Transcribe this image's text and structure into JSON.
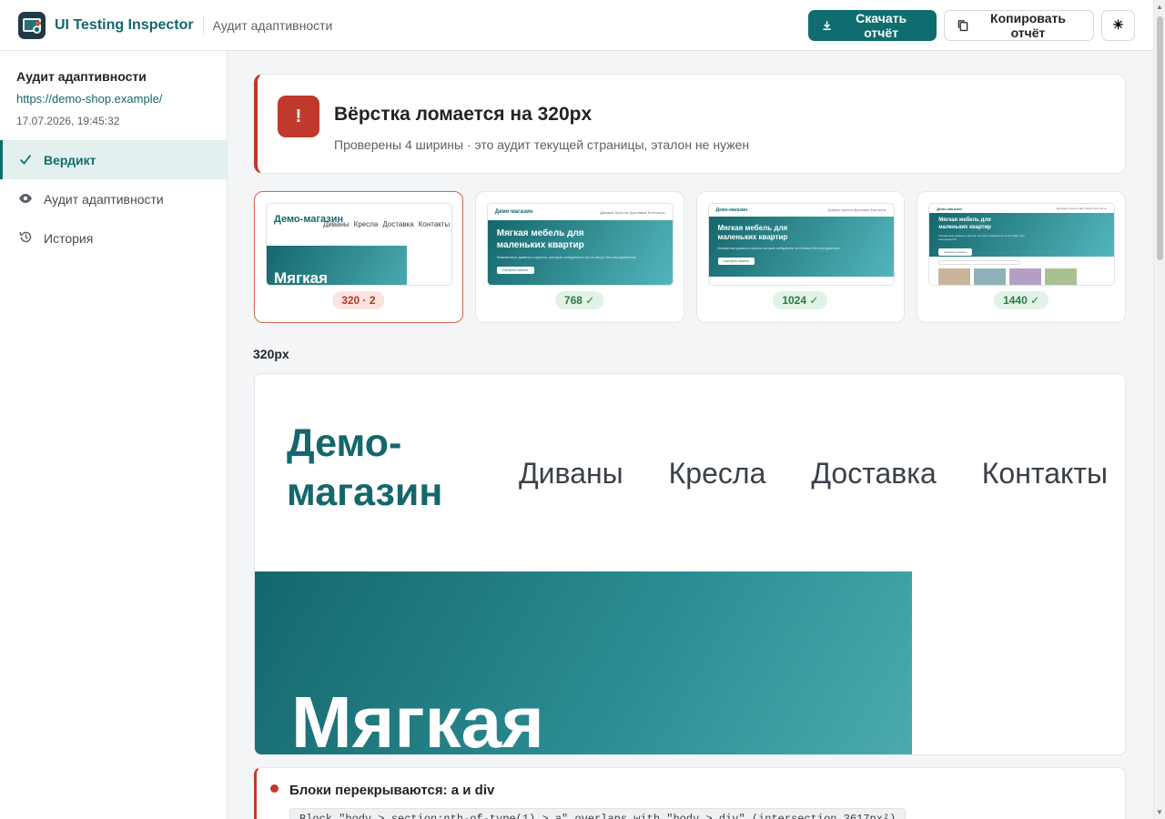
{
  "header": {
    "app_title": "UI Testing Inspector",
    "subtitle": "Аудит адаптивности",
    "download_label": "Скачать отчёт",
    "copy_label": "Копировать отчёт"
  },
  "sidebar": {
    "title": "Аудит адаптивности",
    "url": "https://demo-shop.example/",
    "datetime": "17.07.2026, 19:45:32",
    "items": [
      {
        "label": "Вердикт",
        "icon": "check-icon",
        "active": true
      },
      {
        "label": "Аудит адаптивности",
        "icon": "eye-icon",
        "active": false
      },
      {
        "label": "История",
        "icon": "history-icon",
        "active": false
      }
    ]
  },
  "verdict": {
    "badge": "!",
    "title": "Вёрстка ломается на 320px",
    "subtitle": "Проверены 4 ширины · это аудит текущей страницы, эталон не нужен",
    "color": "#c0392b"
  },
  "thumbnails": [
    {
      "badge": "320 · 2",
      "status": "bad",
      "logo": "Демо-магазин",
      "nav": [
        "Диваны",
        "Кресла",
        "Доставка",
        "Контакты"
      ],
      "hero": "Мягкая"
    },
    {
      "badge": "768 ✓",
      "status": "ok",
      "logo": "Демо-магазин",
      "nav": "Диваны  Кресла  Доставка  Контакты",
      "hero": "Мягкая мебель для маленьких квартир",
      "text": "Компактные диваны и кресла, которые собираются за 15 минут без инструментов.",
      "button": "Смотреть каталог"
    },
    {
      "badge": "1024 ✓",
      "status": "ok",
      "logo": "Демо-магазин",
      "nav": "Диваны  Кресла  Доставка  Контакты",
      "hero": "Мягкая мебель для маленьких квартир",
      "text": "Компактные диваны и кресла, которые собираются за 15 минут без инструментов.",
      "button": "Смотреть каталог"
    },
    {
      "badge": "1440 ✓",
      "status": "ok",
      "logo": "Демо-магазин",
      "nav": "Диваны  Кресла  Доставка  Контакты",
      "hero": "Мягкая мебель для маленьких квартир",
      "text": "Компактные диваны и кресла, которые собираются за 15 минут без инструментов.",
      "button": "Смотреть каталог"
    }
  ],
  "preview": {
    "label": "320px",
    "logo_line1": "Демо-",
    "logo_line2": "магазин",
    "nav": [
      "Диваны",
      "Кресла",
      "Доставка",
      "Контакты"
    ],
    "hero_title": "Мягкая"
  },
  "issue": {
    "title": "Блоки перекрываются: a и div",
    "code": "Block \"body > section:nth-of-type(1) > a\" overlaps with \"body > div\" (intersection 3617px²)"
  },
  "colors": {
    "accent": "#0f6d6f",
    "error": "#c0392b",
    "ok": "#2d7a44"
  }
}
